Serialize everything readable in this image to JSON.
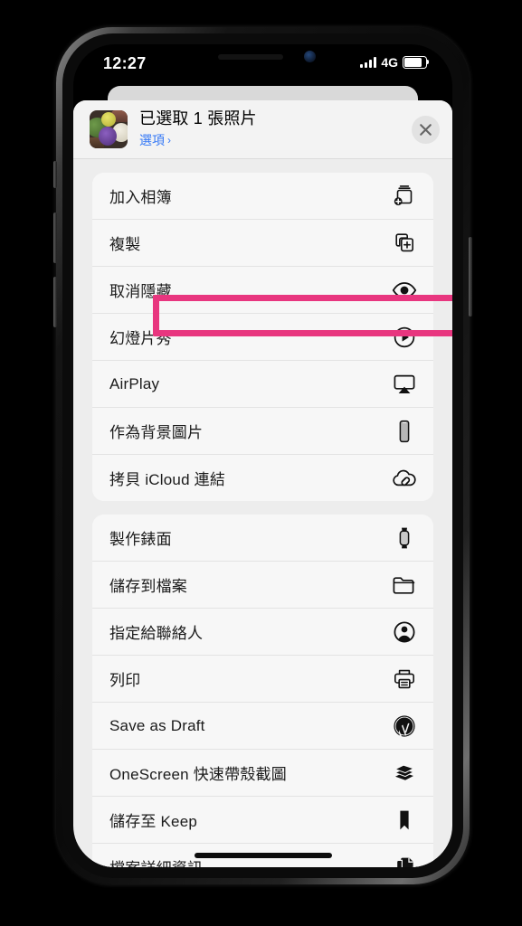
{
  "status_bar": {
    "time": "12:27",
    "network": "4G",
    "signal_icon": "signal-bars-icon",
    "battery_icon": "battery-icon"
  },
  "share_sheet": {
    "header": {
      "thumbnail_alt": "photo-thumbnail",
      "title": "已選取 1 張照片",
      "options_label": "選項",
      "options_chevron": "›",
      "close_icon": "close-icon"
    },
    "groups": [
      {
        "id": "group-primary",
        "rows": [
          {
            "label": "加入相簿",
            "icon": "add-to-album-icon",
            "highlighted": false
          },
          {
            "label": "複製",
            "icon": "duplicate-icon",
            "highlighted": false
          },
          {
            "label": "取消隱藏",
            "icon": "eye-unhide-icon",
            "highlighted": true
          },
          {
            "label": "幻燈片秀",
            "icon": "slideshow-play-icon",
            "highlighted": false
          },
          {
            "label": "AirPlay",
            "icon": "airplay-icon",
            "highlighted": false
          },
          {
            "label": "作為背景圖片",
            "icon": "wallpaper-phone-icon",
            "highlighted": false
          },
          {
            "label": "拷貝 iCloud 連結",
            "icon": "icloud-link-icon",
            "highlighted": false
          }
        ]
      },
      {
        "id": "group-secondary",
        "rows": [
          {
            "label": "製作錶面",
            "icon": "watch-face-icon",
            "highlighted": false
          },
          {
            "label": "儲存到檔案",
            "icon": "folder-icon",
            "highlighted": false
          },
          {
            "label": "指定給聯絡人",
            "icon": "contact-person-icon",
            "highlighted": false
          },
          {
            "label": "列印",
            "icon": "printer-icon",
            "highlighted": false
          },
          {
            "label": "Save as Draft",
            "icon": "wordpress-icon",
            "highlighted": false
          },
          {
            "label": "OneScreen 快速帶殼截圖",
            "icon": "onescreen-layers-icon",
            "highlighted": false
          },
          {
            "label": "儲存至 Keep",
            "icon": "bookmark-icon",
            "highlighted": false
          },
          {
            "label": "檔案詳細資訊",
            "icon": "file-details-icon",
            "highlighted": false
          }
        ]
      }
    ]
  },
  "colors": {
    "highlight": "#e8367f",
    "link_blue": "#3478f6",
    "sheet_background": "#ededed",
    "card_background": "#f7f7f7"
  },
  "home_indicator": "home-indicator"
}
